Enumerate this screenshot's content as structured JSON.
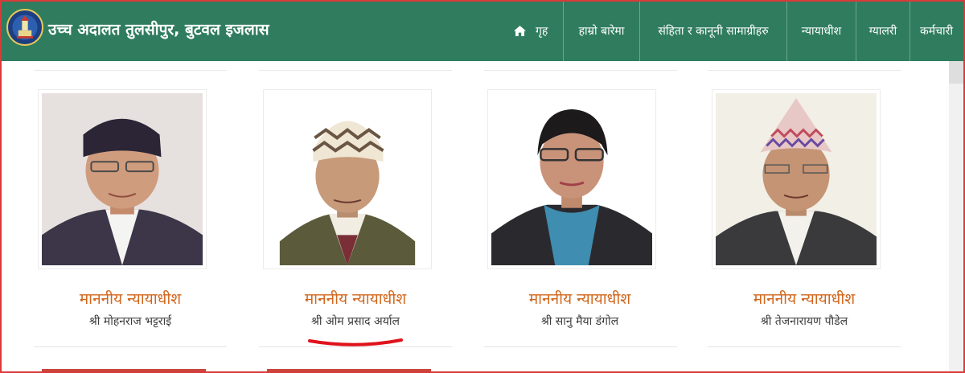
{
  "header": {
    "site_title": "उच्च अदालत तुलसीपुर, बुटवल इजलास",
    "background_color": "#2f7d5e",
    "logo_icon": "court-emblem-icon"
  },
  "nav": {
    "home_icon": "home-icon",
    "items": [
      {
        "label": "गृह"
      },
      {
        "label": "हाम्रो बारेमा"
      },
      {
        "label": "संहिता र कानूनी सामाग्रीहरु"
      },
      {
        "label": "न्यायाधीश"
      },
      {
        "label": "ग्यालरी"
      },
      {
        "label": "कर्मचारी"
      }
    ]
  },
  "judges": [
    {
      "title": "माननीय न्यायाधीश",
      "name": "श्री मोहनराज भट्टराई"
    },
    {
      "title": "माननीय न्यायाधीश",
      "name": "श्री ओम प्रसाद अर्याल"
    },
    {
      "title": "माननीय न्यायाधीश",
      "name": "श्री सानु मैया डंगोल"
    },
    {
      "title": "माननीय न्यायाधीश",
      "name": "श्री तेजनारायण पौडेल"
    }
  ],
  "colors": {
    "accent_title": "#d2661c",
    "annotation_red": "#e0121b",
    "frame_red": "#d93a3a"
  }
}
